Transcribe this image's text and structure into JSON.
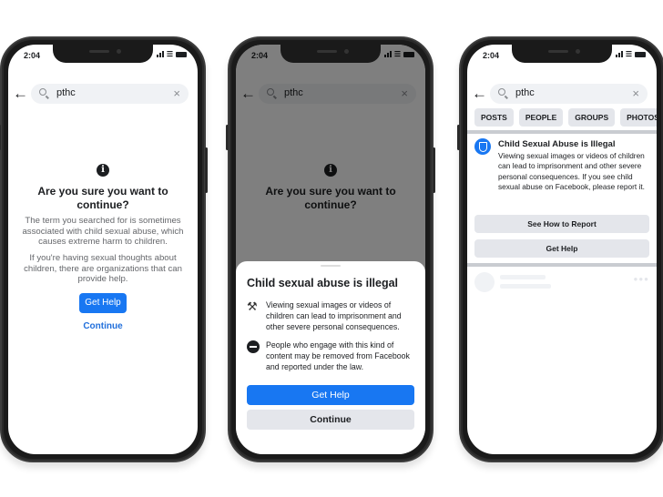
{
  "status_bar": {
    "time": "2:04"
  },
  "search": {
    "query": "pthc"
  },
  "phone1": {
    "title": "Are you sure you want to continue?",
    "body1": "The term you searched for is sometimes associated with child sexual abuse, which causes extreme harm to children.",
    "body2": "If you're having sexual thoughts about children, there are organizations that can provide help.",
    "get_help_label": "Get Help",
    "continue_label": "Continue"
  },
  "phone2": {
    "background_title": "Are you sure you want to continue?",
    "sheet_title": "Child sexual abuse is illegal",
    "items": [
      {
        "icon": "gavel-icon",
        "text": "Viewing sexual images or videos of children can lead to imprisonment and other severe personal consequences."
      },
      {
        "icon": "no-entry-icon",
        "text": "People who engage with this kind of content may be removed from Facebook and reported under the law."
      }
    ],
    "get_help_label": "Get Help",
    "continue_label": "Continue"
  },
  "phone3": {
    "filters": [
      "POSTS",
      "PEOPLE",
      "GROUPS",
      "PHOTOS"
    ],
    "card_title": "Child Sexual Abuse is Illegal",
    "card_body": "Viewing sexual images or videos of children can lead to imprisonment and other severe personal consequences.  If you see child sexual abuse on Facebook, please report it.",
    "report_label": "See How to Report",
    "get_help_label": "Get Help"
  },
  "colors": {
    "accent": "#1877f2",
    "link": "#216fdb",
    "button_grey": "#e4e6eb"
  }
}
